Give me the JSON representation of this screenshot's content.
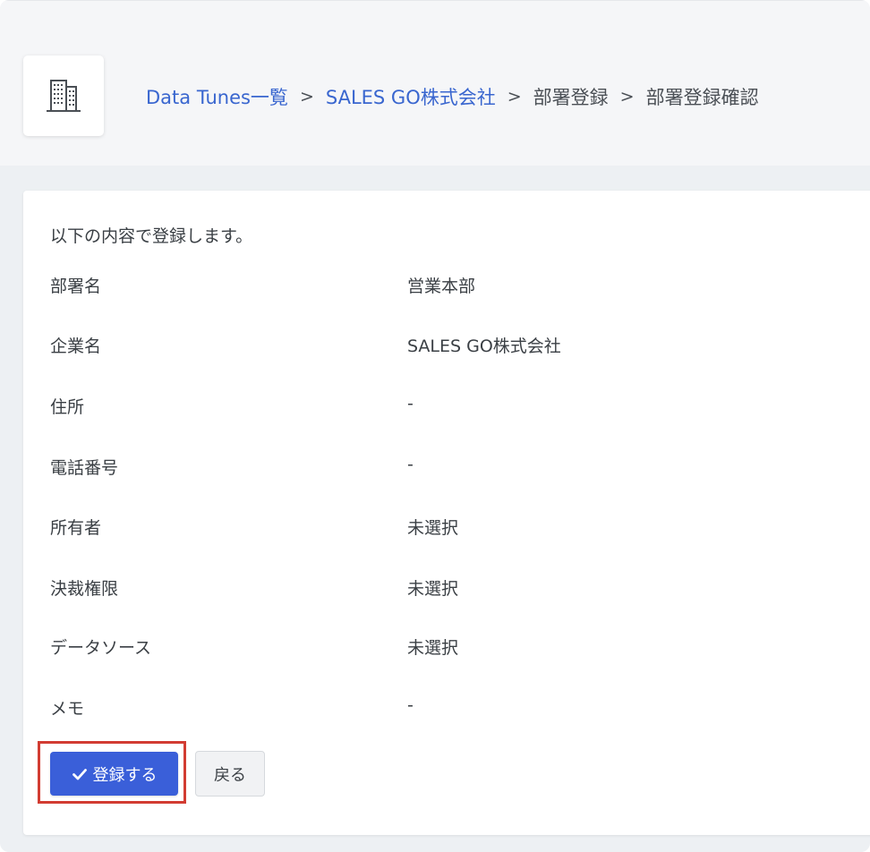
{
  "breadcrumb": {
    "items": [
      {
        "label": "Data Tunes一覧",
        "link": true
      },
      {
        "label": "SALES GO株式会社",
        "link": true
      },
      {
        "label": "部署登録",
        "link": false
      },
      {
        "label": "部署登録確認",
        "link": false
      }
    ],
    "separator": ">"
  },
  "header": {
    "icon": "building-icon"
  },
  "confirm": {
    "intro": "以下の内容で登録します。",
    "fields": [
      {
        "label": "部署名",
        "value": "営業本部"
      },
      {
        "label": "企業名",
        "value": "SALES GO株式会社"
      },
      {
        "label": "住所",
        "value": "-"
      },
      {
        "label": "電話番号",
        "value": "-"
      },
      {
        "label": "所有者",
        "value": "未選択"
      },
      {
        "label": "決裁権限",
        "value": "未選択"
      },
      {
        "label": "データソース",
        "value": "未選択"
      },
      {
        "label": "メモ",
        "value": "-"
      }
    ]
  },
  "actions": {
    "register_label": "登録する",
    "back_label": "戻る"
  },
  "colors": {
    "link": "#3966cf",
    "primary": "#3a5fd9",
    "highlight": "#d23c32"
  }
}
